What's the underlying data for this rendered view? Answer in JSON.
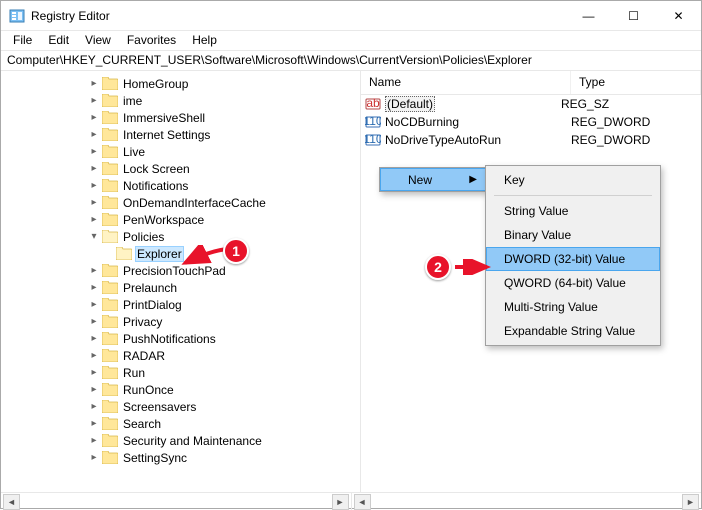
{
  "title": "Registry Editor",
  "window_controls": {
    "min": "—",
    "max": "☐",
    "close": "✕"
  },
  "menu": [
    "File",
    "Edit",
    "View",
    "Favorites",
    "Help"
  ],
  "path": "Computer\\HKEY_CURRENT_USER\\Software\\Microsoft\\Windows\\CurrentVersion\\Policies\\Explorer",
  "tree": [
    {
      "label": "HomeGroup",
      "depth": 6,
      "exp": "r"
    },
    {
      "label": "ime",
      "depth": 6,
      "exp": "r"
    },
    {
      "label": "ImmersiveShell",
      "depth": 6,
      "exp": "r"
    },
    {
      "label": "Internet Settings",
      "depth": 6,
      "exp": "r"
    },
    {
      "label": "Live",
      "depth": 6,
      "exp": "r"
    },
    {
      "label": "Lock Screen",
      "depth": 6,
      "exp": "r"
    },
    {
      "label": "Notifications",
      "depth": 6,
      "exp": "r"
    },
    {
      "label": "OnDemandInterfaceCache",
      "depth": 6,
      "exp": "r"
    },
    {
      "label": "PenWorkspace",
      "depth": 6,
      "exp": "r"
    },
    {
      "label": "Policies",
      "depth": 6,
      "exp": "d"
    },
    {
      "label": "Explorer",
      "depth": 7,
      "exp": "",
      "selected": true
    },
    {
      "label": "PrecisionTouchPad",
      "depth": 6,
      "exp": "r"
    },
    {
      "label": "Prelaunch",
      "depth": 6,
      "exp": "r"
    },
    {
      "label": "PrintDialog",
      "depth": 6,
      "exp": "r"
    },
    {
      "label": "Privacy",
      "depth": 6,
      "exp": "r"
    },
    {
      "label": "PushNotifications",
      "depth": 6,
      "exp": "r"
    },
    {
      "label": "RADAR",
      "depth": 6,
      "exp": "r"
    },
    {
      "label": "Run",
      "depth": 6,
      "exp": "r"
    },
    {
      "label": "RunOnce",
      "depth": 6,
      "exp": "r"
    },
    {
      "label": "Screensavers",
      "depth": 6,
      "exp": "r"
    },
    {
      "label": "Search",
      "depth": 6,
      "exp": "r"
    },
    {
      "label": "Security and Maintenance",
      "depth": 6,
      "exp": "r"
    },
    {
      "label": "SettingSync",
      "depth": 6,
      "exp": "r"
    }
  ],
  "list": {
    "cols": {
      "name": "Name",
      "type": "Type"
    },
    "rows": [
      {
        "name": "(Default)",
        "type": "REG_SZ",
        "icon": "ab",
        "boxed": true
      },
      {
        "name": "NoCDBurning",
        "type": "REG_DWORD",
        "icon": "num"
      },
      {
        "name": "NoDriveTypeAutoRun",
        "type": "REG_DWORD",
        "icon": "num"
      }
    ]
  },
  "context": {
    "primary": {
      "label": "New"
    },
    "sub": [
      "Key",
      "-",
      "String Value",
      "Binary Value",
      "DWORD (32-bit) Value",
      "QWORD (64-bit) Value",
      "Multi-String Value",
      "Expandable String Value"
    ],
    "sub_selected": "DWORD (32-bit) Value"
  },
  "annotations": {
    "badge1": "1",
    "badge2": "2"
  }
}
